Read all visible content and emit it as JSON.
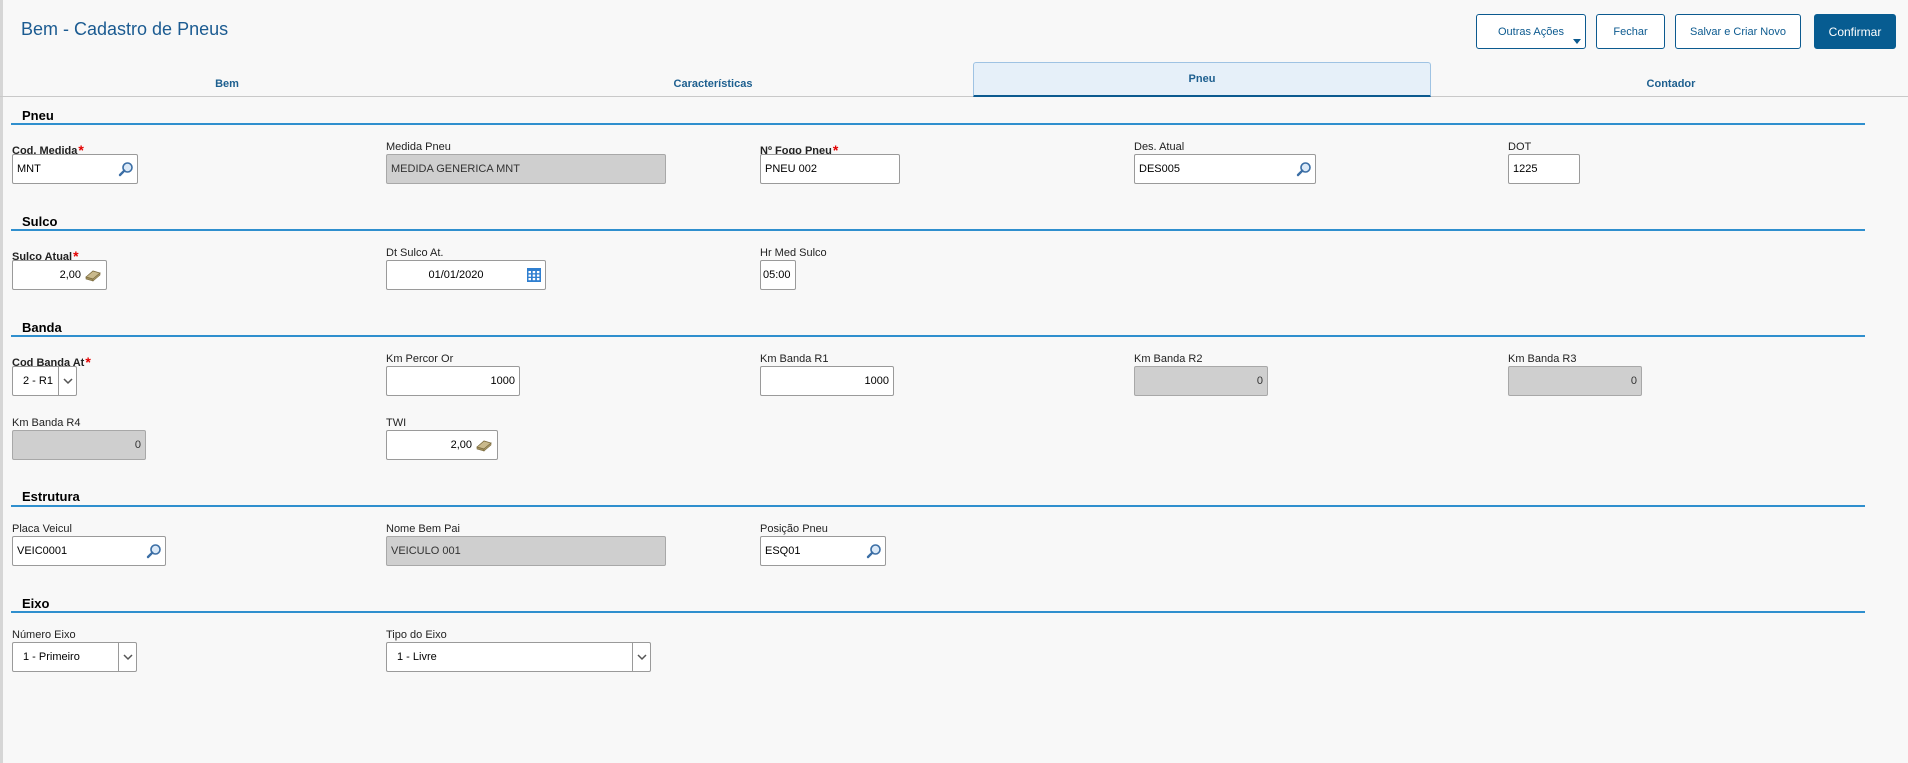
{
  "window": {
    "title": "Bem - Cadastro de Pneus"
  },
  "toolbar": {
    "outras_acoes": "Outras Ações",
    "fechar": "Fechar",
    "salvar_criar_novo": "Salvar e Criar Novo",
    "confirmar": "Confirmar"
  },
  "tabs": [
    {
      "label": "Bem"
    },
    {
      "label": "Características"
    },
    {
      "label": "Pneu",
      "active": true
    },
    {
      "label": "Contador"
    }
  ],
  "sections": {
    "pneu": {
      "title": "Pneu",
      "cod_medida": {
        "label": "Cod. Medida",
        "value": "MNT"
      },
      "medida_pneu": {
        "label": "Medida Pneu",
        "value": "MEDIDA GENERICA MNT"
      },
      "n_fogo_pneu": {
        "label": "Nº Fogo Pneu",
        "value": "PNEU 002"
      },
      "des_atual": {
        "label": "Des. Atual",
        "value": "DES005"
      },
      "dot": {
        "label": "DOT",
        "value": "1225"
      }
    },
    "sulco": {
      "title": "Sulco",
      "sulco_atual": {
        "label": "Sulco Atual",
        "value": "2,00"
      },
      "dt_sulco": {
        "label": "Dt Sulco At.",
        "value": "01/01/2020"
      },
      "hr_med_sulco": {
        "label": "Hr Med Sulco",
        "value": "05:00"
      }
    },
    "banda": {
      "title": "Banda",
      "cod_banda_at": {
        "label": "Cod Banda At",
        "value": "2 - R1"
      },
      "km_percor_or": {
        "label": "Km Percor Or",
        "value": "1000"
      },
      "km_banda_r1": {
        "label": "Km Banda R1",
        "value": "1000"
      },
      "km_banda_r2": {
        "label": "Km Banda R2",
        "value": "0"
      },
      "km_banda_r3": {
        "label": "Km Banda R3",
        "value": "0"
      },
      "km_banda_r4": {
        "label": "Km Banda R4",
        "value": "0"
      },
      "twi": {
        "label": "TWI",
        "value": "2,00"
      }
    },
    "estrutura": {
      "title": "Estrutura",
      "placa_veicul": {
        "label": "Placa Veicul",
        "value": "VEIC0001"
      },
      "nome_bem_pai": {
        "label": "Nome Bem Pai",
        "value": "VEICULO 001"
      },
      "posicao_pneu": {
        "label": "Posição Pneu",
        "value": "ESQ01"
      }
    },
    "eixo": {
      "title": "Eixo",
      "numero_eixo": {
        "label": "Número Eixo",
        "value": "1 - Primeiro"
      },
      "tipo_eixo": {
        "label": "Tipo do Eixo",
        "value": "1 - Livre"
      }
    }
  },
  "colors": {
    "accent": "#075c91",
    "section_line": "#2f8fce",
    "required": "#e30000"
  },
  "icons": [
    "search-icon",
    "calendar-icon",
    "calculator-icon",
    "chevron-down-icon"
  ]
}
